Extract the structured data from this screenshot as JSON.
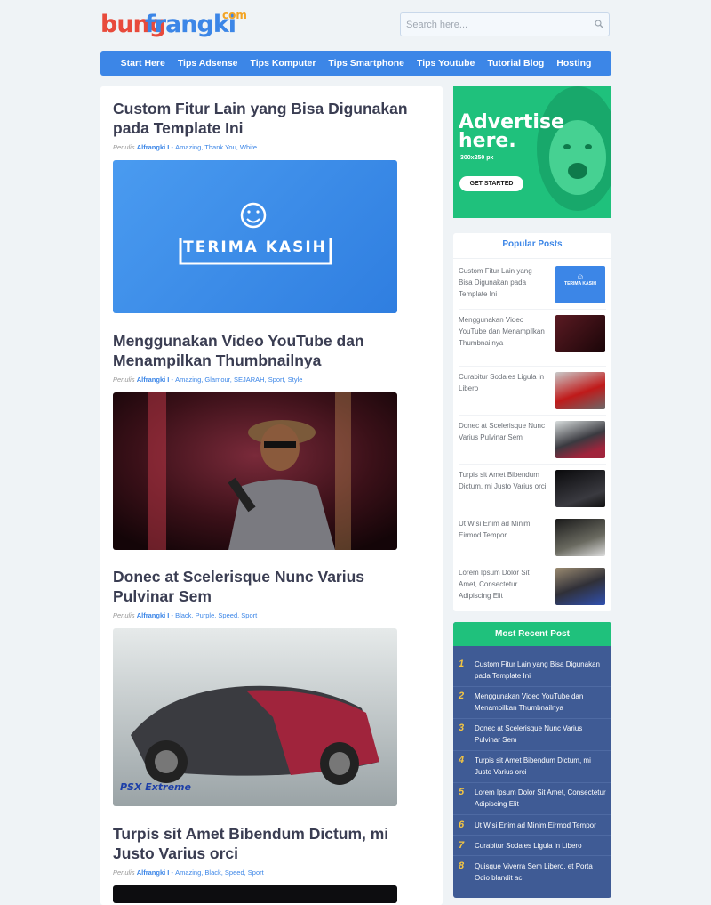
{
  "site": {
    "logo_part1": "bung",
    "logo_part2": "frangki",
    "logo_part3": "com"
  },
  "search": {
    "placeholder": "Search here..."
  },
  "nav": {
    "items": [
      "Start Here",
      "Tips Adsense",
      "Tips Komputer",
      "Tips Smartphone",
      "Tips Youtube",
      "Tutorial Blog",
      "Hosting"
    ]
  },
  "posts": [
    {
      "title": "Custom Fitur Lain yang Bisa Digunakan pada Template Ini",
      "meta_prefix": "Penulis",
      "author": "Alfrangki I",
      "sep": "-",
      "tags": "Amazing, Thank You, White",
      "image_text": "TERIMA KASIH"
    },
    {
      "title": "Menggunakan Video YouTube dan Menampilkan Thumbnailnya",
      "meta_prefix": "Penulis",
      "author": "Alfrangki I",
      "sep": "-",
      "tags": "Amazing, Glamour, SEJARAH, Sport, Style"
    },
    {
      "title": "Donec at Scelerisque Nunc Varius Pulvinar Sem",
      "meta_prefix": "Penulis",
      "author": "Alfrangki I",
      "sep": "-",
      "tags": "Black, Purple, Speed, Sport",
      "watermark": "PSX Extreme"
    },
    {
      "title": "Turpis sit Amet Bibendum Dictum, mi Justo Varius orci",
      "meta_prefix": "Penulis",
      "author": "Alfrangki I",
      "sep": "-",
      "tags": "Amazing, Black, Speed, Sport"
    }
  ],
  "ad": {
    "line1": "Advertise",
    "line2": "here.",
    "size": "300x250 px",
    "button": "GET STARTED"
  },
  "popular": {
    "title": "Popular Posts",
    "items": [
      "Custom Fitur Lain yang Bisa Digunakan pada Template Ini",
      "Menggunakan Video YouTube dan Menampilkan Thumbnailnya",
      "Curabitur Sodales Ligula in Libero",
      "Donec at Scelerisque Nunc Varius Pulvinar Sem",
      "Turpis sit Amet Bibendum Dictum, mi Justo Varius orci",
      "Ut Wisi Enim ad Minim Eirmod Tempor",
      "Lorem Ipsum Dolor Sit Amet, Consectetur Adipiscing Elit"
    ],
    "thumb_text": "TERIMA KASIH"
  },
  "recent": {
    "title": "Most Recent Post",
    "items": [
      {
        "num": "1",
        "text": "Custom Fitur Lain yang Bisa Digunakan pada Template Ini"
      },
      {
        "num": "2",
        "text": "Menggunakan Video YouTube dan Menampilkan Thumbnailnya"
      },
      {
        "num": "3",
        "text": "Donec at Scelerisque Nunc Varius Pulvinar Sem"
      },
      {
        "num": "4",
        "text": "Turpis sit Amet Bibendum Dictum, mi Justo Varius orci"
      },
      {
        "num": "5",
        "text": "Lorem Ipsum Dolor Sit Amet, Consectetur Adipiscing Elit"
      },
      {
        "num": "6",
        "text": "Ut Wisi Enim ad Minim Eirmod Tempor"
      },
      {
        "num": "7",
        "text": "Curabitur Sodales Ligula in Libero"
      },
      {
        "num": "8",
        "text": "Quisque Viverra Sem Libero, et Porta Odio blandit ac"
      }
    ]
  },
  "colors": {
    "accent": "#3c86e7",
    "green": "#1fc17c",
    "navy": "#3f5b95",
    "logo_red": "#e84a3b",
    "logo_orange": "#f3a424"
  }
}
